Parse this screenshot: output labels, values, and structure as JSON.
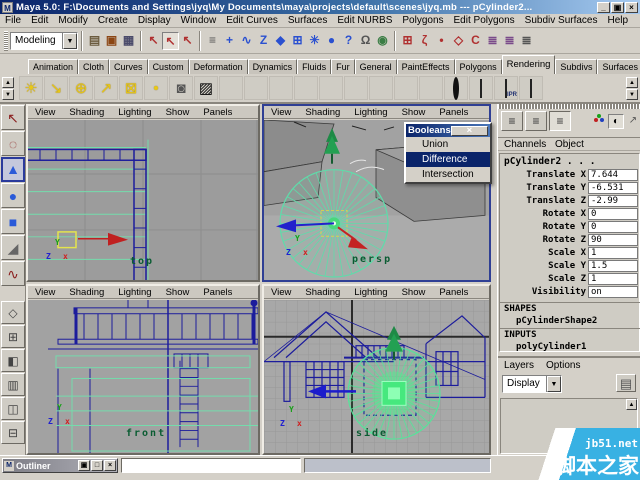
{
  "window": {
    "icon": "M",
    "title": "Maya 5.0: F:\\Documents and Settings\\jyq\\My Documents\\maya\\projects\\default\\scenes\\jyq.mb --- pCylinder2...",
    "minimize": "_",
    "restore": "▣",
    "close": "×"
  },
  "menubar": {
    "items": [
      "File",
      "Edit",
      "Modify",
      "Create",
      "Display",
      "Window",
      "Edit Curves",
      "Surfaces",
      "Edit NURBS",
      "Polygons",
      "Edit Polygons",
      "Subdiv Surfaces",
      "Help"
    ]
  },
  "toolbar": {
    "mode_selector": "Modeling",
    "dropdown_arrow": "▼",
    "icons": [
      {
        "name": "new-scene",
        "glyph": "▤"
      },
      {
        "name": "open-scene",
        "glyph": "▣"
      },
      {
        "name": "save-scene",
        "glyph": "▦"
      },
      {
        "name": "select-hierarchy",
        "glyph": "↖"
      },
      {
        "name": "select-object",
        "glyph": "↖"
      },
      {
        "name": "select-component",
        "glyph": "↖"
      },
      {
        "name": "pickmask-expand",
        "glyph": "≡"
      },
      {
        "name": "pickmask-points",
        "glyph": "+"
      },
      {
        "name": "pickmask-curves",
        "glyph": "∿"
      },
      {
        "name": "pickmask-curves2",
        "glyph": "Z"
      },
      {
        "name": "pickmask-surfaces",
        "glyph": "◆"
      },
      {
        "name": "pickmask-deformations",
        "glyph": "⊞"
      },
      {
        "name": "pickmask-dynamics",
        "glyph": "✳"
      },
      {
        "name": "pickmask-rendering",
        "glyph": "●"
      },
      {
        "name": "pickmask-misc",
        "glyph": "?"
      },
      {
        "name": "lock",
        "glyph": "Ω"
      },
      {
        "name": "highlight-selection",
        "glyph": "◉"
      },
      {
        "name": "snap-to-grids",
        "glyph": "⊞"
      },
      {
        "name": "snap-to-curves",
        "glyph": "ζ"
      },
      {
        "name": "snap-to-points",
        "glyph": "•"
      },
      {
        "name": "snap-to-view-planes",
        "glyph": "◇"
      },
      {
        "name": "make-live",
        "glyph": "C"
      },
      {
        "name": "input-connections",
        "glyph": "≣"
      },
      {
        "name": "output-connections",
        "glyph": "≣"
      },
      {
        "name": "construction-history",
        "glyph": "≣"
      }
    ]
  },
  "shelf": {
    "tabs": [
      "Animation",
      "Cloth",
      "Curves",
      "Custom",
      "Deformation",
      "Dynamics",
      "Fluids",
      "Fur",
      "General",
      "PaintEffects",
      "Polygons",
      "Rendering",
      "Subdivs",
      "Surfaces"
    ],
    "active_tab": "Rendering",
    "scroll_up": "▲",
    "scroll_down": "▼",
    "mini_up": "▲",
    "mini_down": "▼",
    "ipr_label": "IPR",
    "light_icons": [
      {
        "name": "point-light",
        "glyph": "☀"
      },
      {
        "name": "spot-light",
        "glyph": "↘"
      },
      {
        "name": "directional-light",
        "glyph": "⊕"
      },
      {
        "name": "area-light",
        "glyph": "↗"
      },
      {
        "name": "volume-light",
        "glyph": "⊠"
      },
      {
        "name": "ambient-light",
        "glyph": "•"
      },
      {
        "name": "camera",
        "glyph": "◙"
      },
      {
        "name": "paint-canvas",
        "glyph": "▨"
      }
    ]
  },
  "toolbox": {
    "tools": [
      {
        "name": "select-tool",
        "glyph": "↖"
      },
      {
        "name": "lasso-tool",
        "glyph": "◌"
      },
      {
        "name": "move-tool",
        "glyph": "▲"
      },
      {
        "name": "rotate-tool",
        "glyph": "●"
      },
      {
        "name": "scale-tool",
        "glyph": "■"
      },
      {
        "name": "show-manipulator-tool",
        "glyph": "◢"
      },
      {
        "name": "curve-edit-tool",
        "glyph": "∿"
      }
    ],
    "layouts": [
      {
        "name": "layout-single-pane",
        "glyph": "◇"
      },
      {
        "name": "layout-four-pane",
        "glyph": "⊞"
      },
      {
        "name": "layout-persp-outliner",
        "glyph": "◧"
      },
      {
        "name": "layout-persp-graph",
        "glyph": "▥"
      },
      {
        "name": "layout-hypergraph",
        "glyph": "◫"
      },
      {
        "name": "layout-multi",
        "glyph": "⊟"
      }
    ]
  },
  "viewport_menu": {
    "items": [
      "View",
      "Shading",
      "Lighting",
      "Show",
      "Panels"
    ]
  },
  "viewports": {
    "top_label": "top",
    "persp_label": "persp",
    "front_label": "front",
    "side_label": "side"
  },
  "axis": {
    "x": "x",
    "y": "Y",
    "z": "Z"
  },
  "booleans_menu": {
    "title": "Booleans",
    "close": "×",
    "items": [
      "Union",
      "Difference",
      "Intersection"
    ],
    "selected": "Difference"
  },
  "channel_box": {
    "menus": [
      "Channels",
      "Object"
    ],
    "mode_icons": [
      {
        "name": "manip-off",
        "glyph": "≡"
      },
      {
        "name": "manip-default",
        "glyph": "≡"
      },
      {
        "name": "manip-all",
        "glyph": "≡"
      }
    ],
    "speed_icons": [
      {
        "name": "speed-slow",
        "glyph": "◐"
      },
      {
        "name": "speed-fast",
        "glyph": "↗"
      }
    ],
    "object_name": "pCylinder2 . . .",
    "channels": [
      {
        "label": "Translate X",
        "value": "7.644"
      },
      {
        "label": "Translate Y",
        "value": "-6.531"
      },
      {
        "label": "Translate Z",
        "value": "-2.99"
      },
      {
        "label": "Rotate X",
        "value": "0"
      },
      {
        "label": "Rotate Y",
        "value": "0"
      },
      {
        "label": "Rotate Z",
        "value": "90"
      },
      {
        "label": "Scale X",
        "value": "1"
      },
      {
        "label": "Scale Y",
        "value": "1.5"
      },
      {
        "label": "Scale Z",
        "value": "1"
      },
      {
        "label": "Visibility",
        "value": "on"
      }
    ],
    "shapes_header": "SHAPES",
    "shape_name": "pCylinderShape2",
    "inputs_header": "INPUTS",
    "input_name": "polyCylinder1"
  },
  "layers_panel": {
    "menus": [
      "Layers",
      "Options"
    ],
    "display_selector": "Display",
    "dropdown_arrow": "▼",
    "layers_icon": "▤",
    "scroll_up": "▲"
  },
  "outliner_bar": {
    "icon": "M",
    "title": "Outliner",
    "restore": "▣",
    "maximize": "□",
    "close": "×"
  },
  "command_line": {
    "value": ""
  },
  "watermark": {
    "site": "jb51.net",
    "name": "脚本之家",
    "color": "#38b1e3"
  }
}
